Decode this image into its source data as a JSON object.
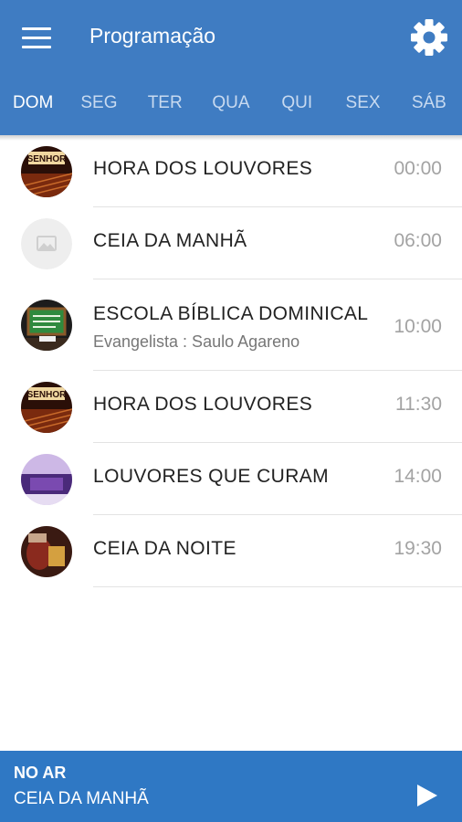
{
  "header": {
    "title": "Programação",
    "menu_icon": "hamburger-menu-icon",
    "settings_icon": "gear-icon",
    "color": "#3f7cc2"
  },
  "tabs": [
    {
      "label": "DOM",
      "active": true
    },
    {
      "label": "SEG"
    },
    {
      "label": "TER"
    },
    {
      "label": "QUA"
    },
    {
      "label": "QUI"
    },
    {
      "label": "SEX"
    },
    {
      "label": "SÁB"
    }
  ],
  "programs": [
    {
      "title": "HORA DOS LOUVORES",
      "subtitle": "",
      "time": "00:00",
      "thumb": "louvores"
    },
    {
      "title": "CEIA DA MANHÃ",
      "subtitle": "",
      "time": "06:00",
      "thumb": "placeholder-image-icon"
    },
    {
      "title": "ESCOLA BÍBLICA DOMINICAL",
      "subtitle": "Evangelista : Saulo Agareno",
      "time": "10:00",
      "thumb": "escola"
    },
    {
      "title": "HORA DOS LOUVORES",
      "subtitle": "",
      "time": "11:30",
      "thumb": "louvores"
    },
    {
      "title": "LOUVORES QUE CURAM",
      "subtitle": "",
      "time": "14:00",
      "thumb": "curam"
    },
    {
      "title": "CEIA DA NOITE",
      "subtitle": "",
      "time": "19:30",
      "thumb": "noite"
    }
  ],
  "now_playing": {
    "label": "NO AR",
    "title": "CEIA DA MANHÃ",
    "play_icon": "play-icon",
    "color": "#2f78c4"
  }
}
